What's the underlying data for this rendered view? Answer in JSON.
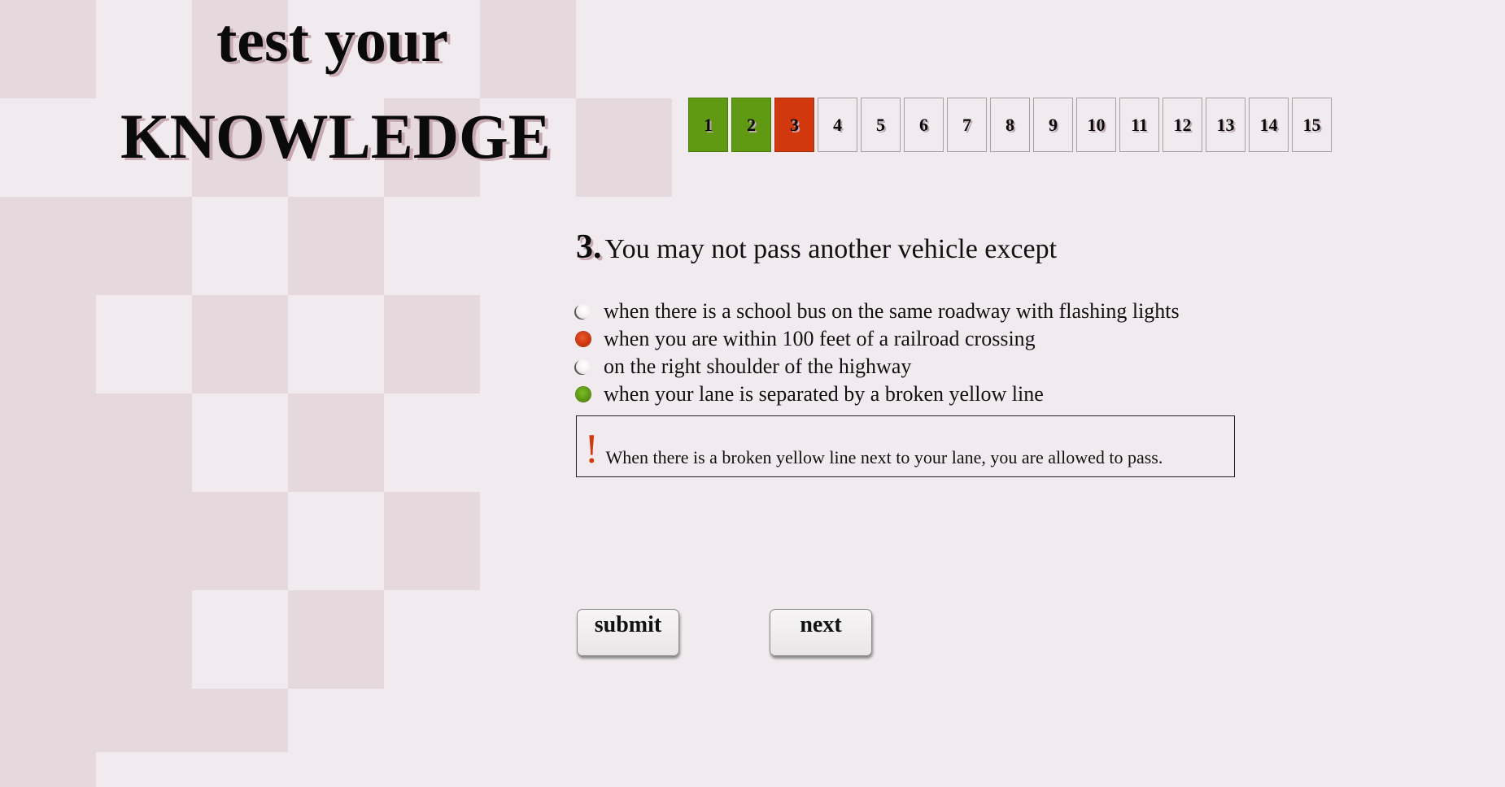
{
  "title": {
    "line1": "test your",
    "line2": "KNOWLEDGE"
  },
  "question_nav": [
    {
      "label": "1",
      "status": "correct"
    },
    {
      "label": "2",
      "status": "correct"
    },
    {
      "label": "3",
      "status": "wrong"
    },
    {
      "label": "4",
      "status": "unanswered"
    },
    {
      "label": "5",
      "status": "unanswered"
    },
    {
      "label": "6",
      "status": "unanswered"
    },
    {
      "label": "7",
      "status": "unanswered"
    },
    {
      "label": "8",
      "status": "unanswered"
    },
    {
      "label": "9",
      "status": "unanswered"
    },
    {
      "label": "10",
      "status": "unanswered"
    },
    {
      "label": "11",
      "status": "unanswered"
    },
    {
      "label": "12",
      "status": "unanswered"
    },
    {
      "label": "13",
      "status": "unanswered"
    },
    {
      "label": "14",
      "status": "unanswered"
    },
    {
      "label": "15",
      "status": "unanswered"
    }
  ],
  "question": {
    "number": "3.",
    "text": "You may not pass another vehicle except",
    "answers": [
      {
        "label": "when there is a school bus on the same roadway with flashing lights",
        "state": "none"
      },
      {
        "label": "when you are within 100 feet of a railroad crossing",
        "state": "selected-wrong"
      },
      {
        "label": "on the right shoulder of the highway",
        "state": "none"
      },
      {
        "label": "when your lane is separated by a broken yellow line",
        "state": "correct"
      }
    ]
  },
  "feedback": {
    "mark": "!",
    "text": "When there is a broken yellow line next to your lane, you are allowed to pass."
  },
  "buttons": {
    "submit": "submit",
    "next": "next"
  },
  "colors": {
    "background": "#f1eaee",
    "tile": "#e6d9de",
    "correct": "#5f9a12",
    "wrong": "#d2380e"
  }
}
